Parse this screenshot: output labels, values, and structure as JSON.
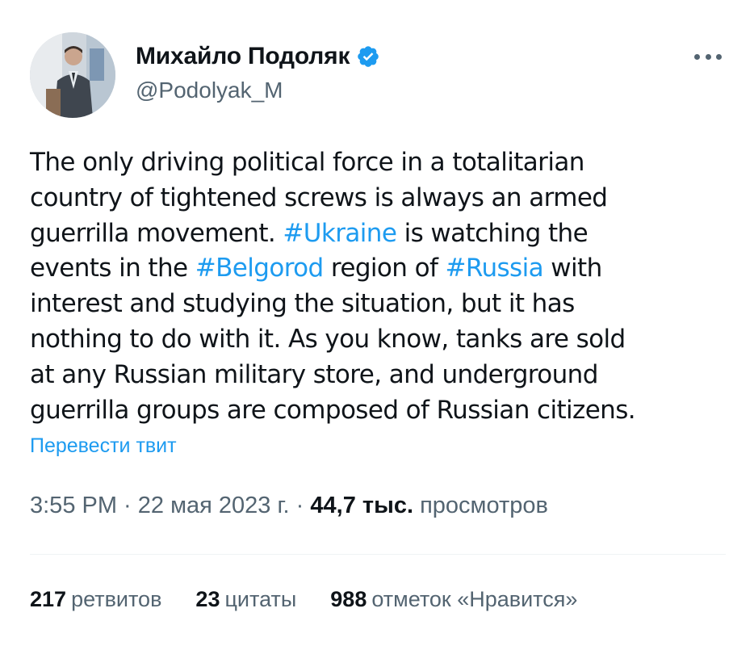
{
  "author": {
    "display_name": "Михайло Подоляк",
    "handle": "@Podolyak_M",
    "verified": true,
    "verified_color": "#1d9bf0"
  },
  "tweet": {
    "lines": [
      [
        {
          "text": "The only driving political force in a totalitarian"
        }
      ],
      [
        {
          "text": "country of tightened screws is always an armed"
        }
      ],
      [
        {
          "text": "guerrilla movement. "
        },
        {
          "text": "#Ukraine",
          "hashtag": true
        },
        {
          "text": " is watching the"
        }
      ],
      [
        {
          "text": "events in the "
        },
        {
          "text": "#Belgorod",
          "hashtag": true
        },
        {
          "text": " region of "
        },
        {
          "text": "#Russia",
          "hashtag": true
        },
        {
          "text": " with"
        }
      ],
      [
        {
          "text": "interest and studying the situation, but it has"
        }
      ],
      [
        {
          "text": "nothing to do with it. As you know, tanks are sold"
        }
      ],
      [
        {
          "text": "at any Russian military store, and underground"
        }
      ],
      [
        {
          "text": "guerrilla groups are composed of Russian citizens."
        }
      ]
    ],
    "translate_label": "Перевести твит",
    "time": "3:55 PM",
    "separator": " · ",
    "date": "22 мая 2023 г.",
    "views_count": "44,7 тыс.",
    "views_label": "просмотров"
  },
  "stats": {
    "retweets_count": "217",
    "retweets_label": "ретвитов",
    "quotes_count": "23",
    "quotes_label": "цитаты",
    "likes_count": "988",
    "likes_label": "отметок «Нравится»"
  },
  "colors": {
    "link": "#1d9bf0",
    "text": "#0f1419",
    "secondary": "#536471"
  }
}
